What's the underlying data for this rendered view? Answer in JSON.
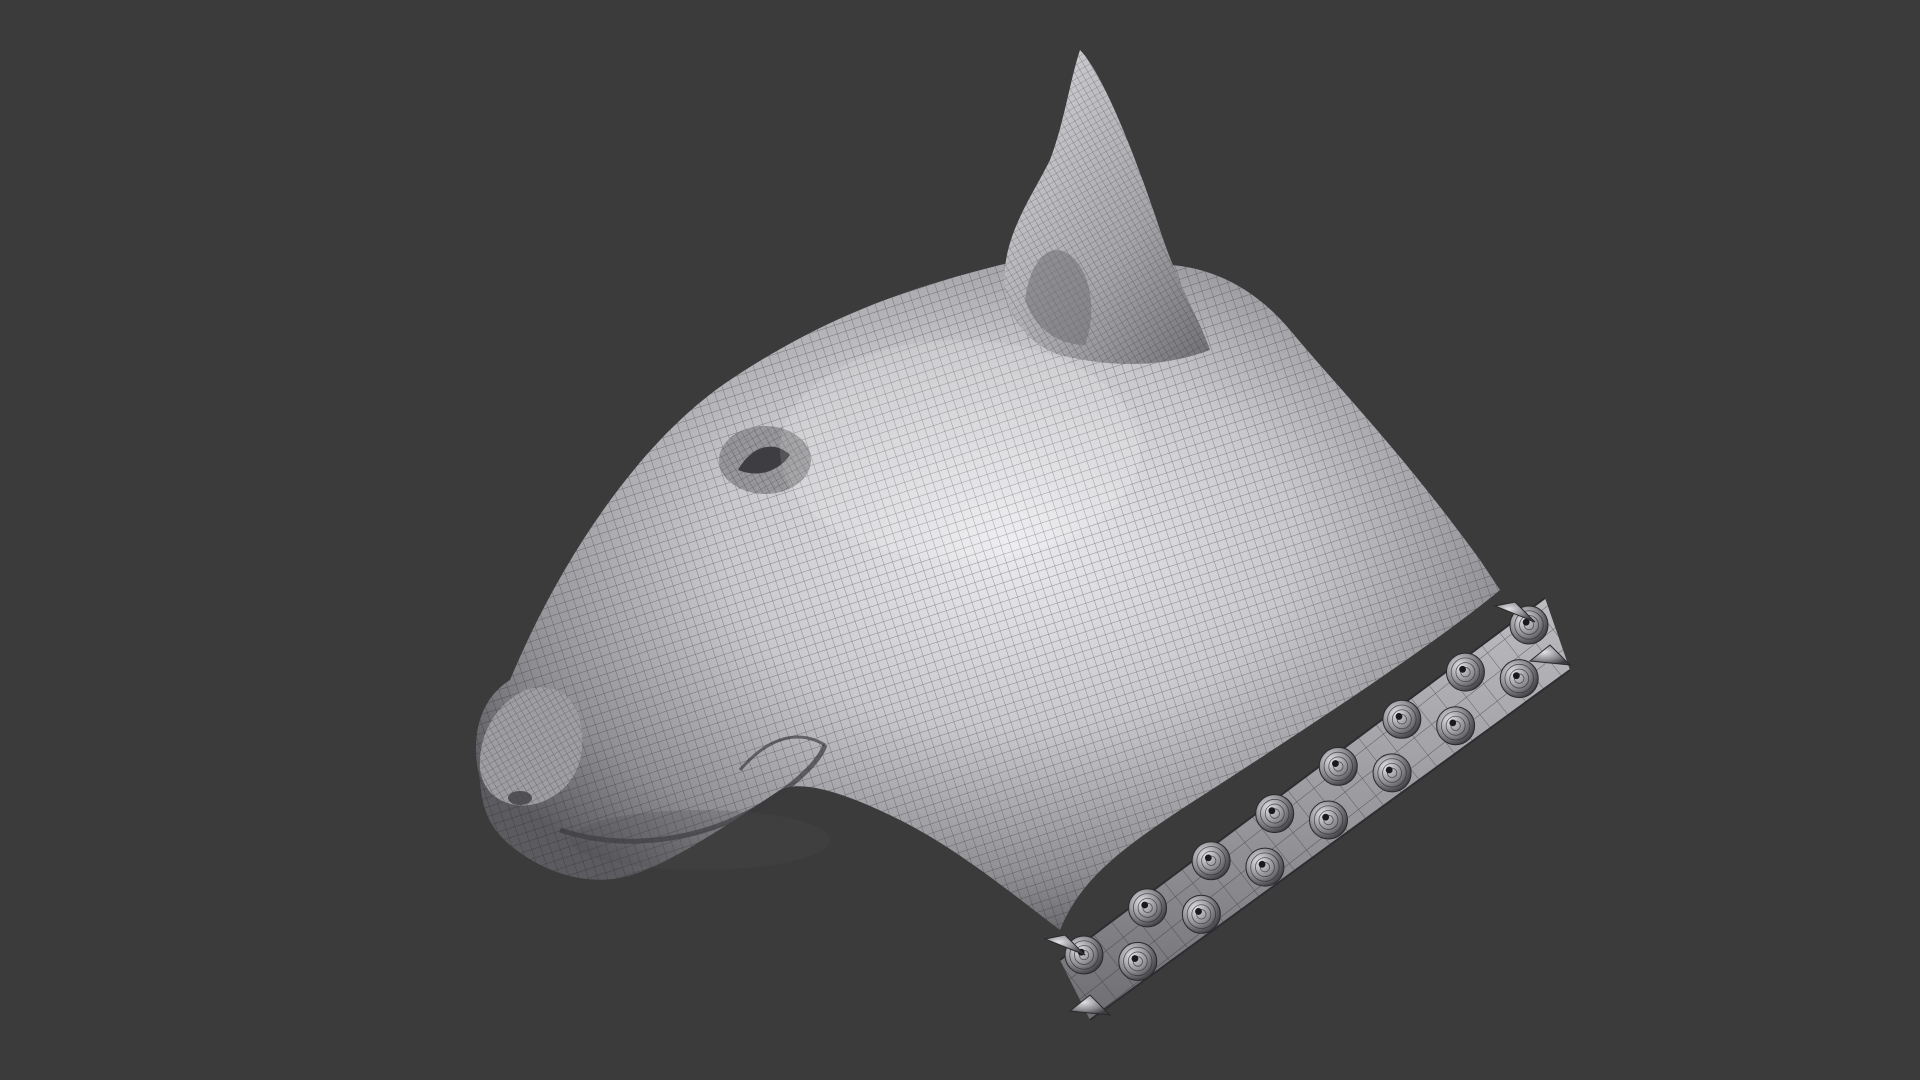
{
  "viewport": {
    "background_color": "#3b3b3b",
    "subject": "dog-head-wireframe-model",
    "shading": "grey-solid-with-wireframe",
    "colors": {
      "mesh_light": "#e6e6ea",
      "mesh_mid": "#a9a9ad",
      "mesh_dark": "#4a4a4e",
      "wire": "#1c1c1e",
      "stud": "#6a6a6e"
    },
    "collar": {
      "stud_rows": 2,
      "stud_style": "conical-spikes"
    }
  }
}
